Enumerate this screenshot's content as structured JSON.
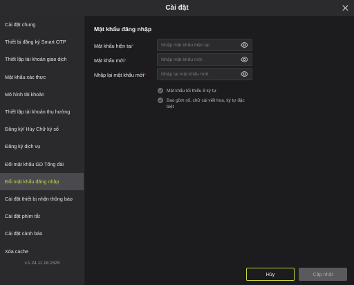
{
  "window": {
    "title": "Cài đặt"
  },
  "sidebar": {
    "items": [
      {
        "label": "Cài đặt chung"
      },
      {
        "label": "Thiết bị đăng ký Smart OTP"
      },
      {
        "label": "Thiết lập tài khoản giao dịch"
      },
      {
        "label": "Mật khẩu xác thực"
      },
      {
        "label": "Mô hình tài khoản"
      },
      {
        "label": "Thiết lập tài khoản thụ hưởng"
      },
      {
        "label": "Đăng ký/ Hủy Chữ ký số"
      },
      {
        "label": "Đăng ký dịch vụ"
      },
      {
        "label": "Đổi mật khẩu GD Tổng đài"
      },
      {
        "label": "Đổi mật khẩu đăng nhập"
      },
      {
        "label": "Cài đặt thiết bị nhận thông báo"
      },
      {
        "label": "Cài đặt phím tắt"
      },
      {
        "label": "Cài đặt cảnh báo"
      },
      {
        "label": "Xóa cache"
      }
    ],
    "active_index": 9,
    "version": "v.1.24.11.18.1529"
  },
  "main": {
    "section_title": "Mật khẩu đăng nhập",
    "fields": [
      {
        "label": "Mật khẩu hiện tại",
        "required": "*",
        "placeholder": "Nhập mật khẩu hiện tại",
        "value": ""
      },
      {
        "label": "Mật khẩu mới",
        "required": "*",
        "placeholder": "Nhập mật khẩu mới",
        "value": ""
      },
      {
        "label": "Nhập lại mật khẩu mới",
        "required": "*",
        "placeholder": "Nhập lại mật khẩu mới",
        "value": ""
      }
    ],
    "rules": [
      {
        "text": "Mật khẩu tối thiểu 8 ký tự"
      },
      {
        "text": "Bao gồm số, chữ cái viết hoa, ký tự đặc biệt"
      }
    ],
    "buttons": {
      "cancel": "Hủy",
      "update": "Cập nhật"
    }
  },
  "colors": {
    "accent": "#c8d640",
    "required": "#e5484d",
    "background": "#1c1c1e",
    "sidebar": "#2a2a2d",
    "active_item": "#4a4a4e"
  },
  "icons": {
    "close": "close-icon",
    "eye": "eye-icon",
    "check": "check-circle-icon"
  }
}
